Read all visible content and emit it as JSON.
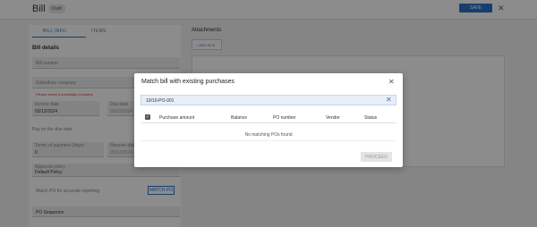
{
  "header": {
    "title": "Bill",
    "badge": "Draft",
    "save_label": "SAVE",
    "close_glyph": "✕"
  },
  "tabs": [
    {
      "label": "BILL INFO"
    },
    {
      "label": "ITEMS"
    }
  ],
  "left": {
    "section_title": "Bill details",
    "bill_number_placeholder": "Bill number",
    "subsidiary_placeholder": "Subsidiary company",
    "subsidiary_error": "Please select a subsidiary company",
    "invoice_date_label": "Invoice date",
    "invoice_date_value": "03/13/2024",
    "due_date_label": "Due date",
    "due_date_value": "03/13/2024",
    "pay_on_due": "Pay on the due date",
    "terms_label": "Terms of payment (days)",
    "terms_value": "0",
    "receive_date_label": "Receive date",
    "receive_date_value": "03/13/2024",
    "approval_label": "Approval policy",
    "approval_value": "Default Policy",
    "match_hint": "Match PO for accurate reporting",
    "match_btn": "MATCH PO",
    "po_select": "PO Sequence"
  },
  "attachments": {
    "title": "Attachments",
    "add_label": "+ ADD FILE"
  },
  "modal": {
    "title": "Match bill with existing purchases",
    "close_glyph": "✕",
    "search_value": "10/10-PO-001",
    "clear_glyph": "✕",
    "columns": [
      "Purchase amount",
      "Balance",
      "PO number",
      "Vendor",
      "Status"
    ],
    "empty_message": "No matching POs found",
    "proceed_label": "PROCEED"
  }
}
